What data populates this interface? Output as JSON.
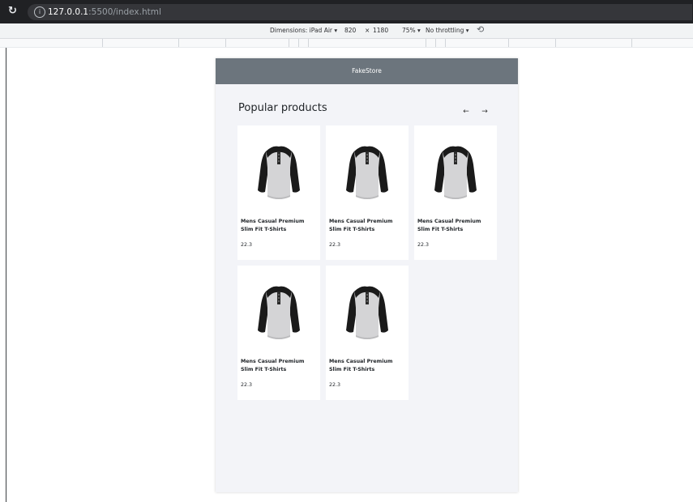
{
  "browser": {
    "url_host": "127.0.0.1",
    "url_path": ":5500/index.html"
  },
  "device_toolbar": {
    "dimensions_label": "Dimensions: iPad Air ▾",
    "width": "820",
    "times": "×",
    "height": "1180",
    "zoom": "75% ▾",
    "throttling": "No throttling ▾"
  },
  "header": {
    "brand": "FakeStore",
    "color": "#6c757d"
  },
  "section": {
    "title": "Popular products",
    "prev_arrow": "←",
    "next_arrow": "→"
  },
  "products": [
    {
      "title": "Mens Casual Premium Slim Fit T-Shirts",
      "price": "22.3"
    },
    {
      "title": "Mens Casual Premium Slim Fit T-Shirts",
      "price": "22.3"
    },
    {
      "title": "Mens Casual Premium Slim Fit T-Shirts",
      "price": "22.3"
    },
    {
      "title": "Mens Casual Premium Slim Fit T-Shirts",
      "price": "22.3"
    },
    {
      "title": "Mens Casual Premium Slim Fit T-Shirts",
      "price": "22.3"
    }
  ],
  "icons": {
    "reload": "reload-icon",
    "info": "info-icon",
    "rotate": "rotate-icon",
    "product_image": "henley-shirt-icon"
  }
}
